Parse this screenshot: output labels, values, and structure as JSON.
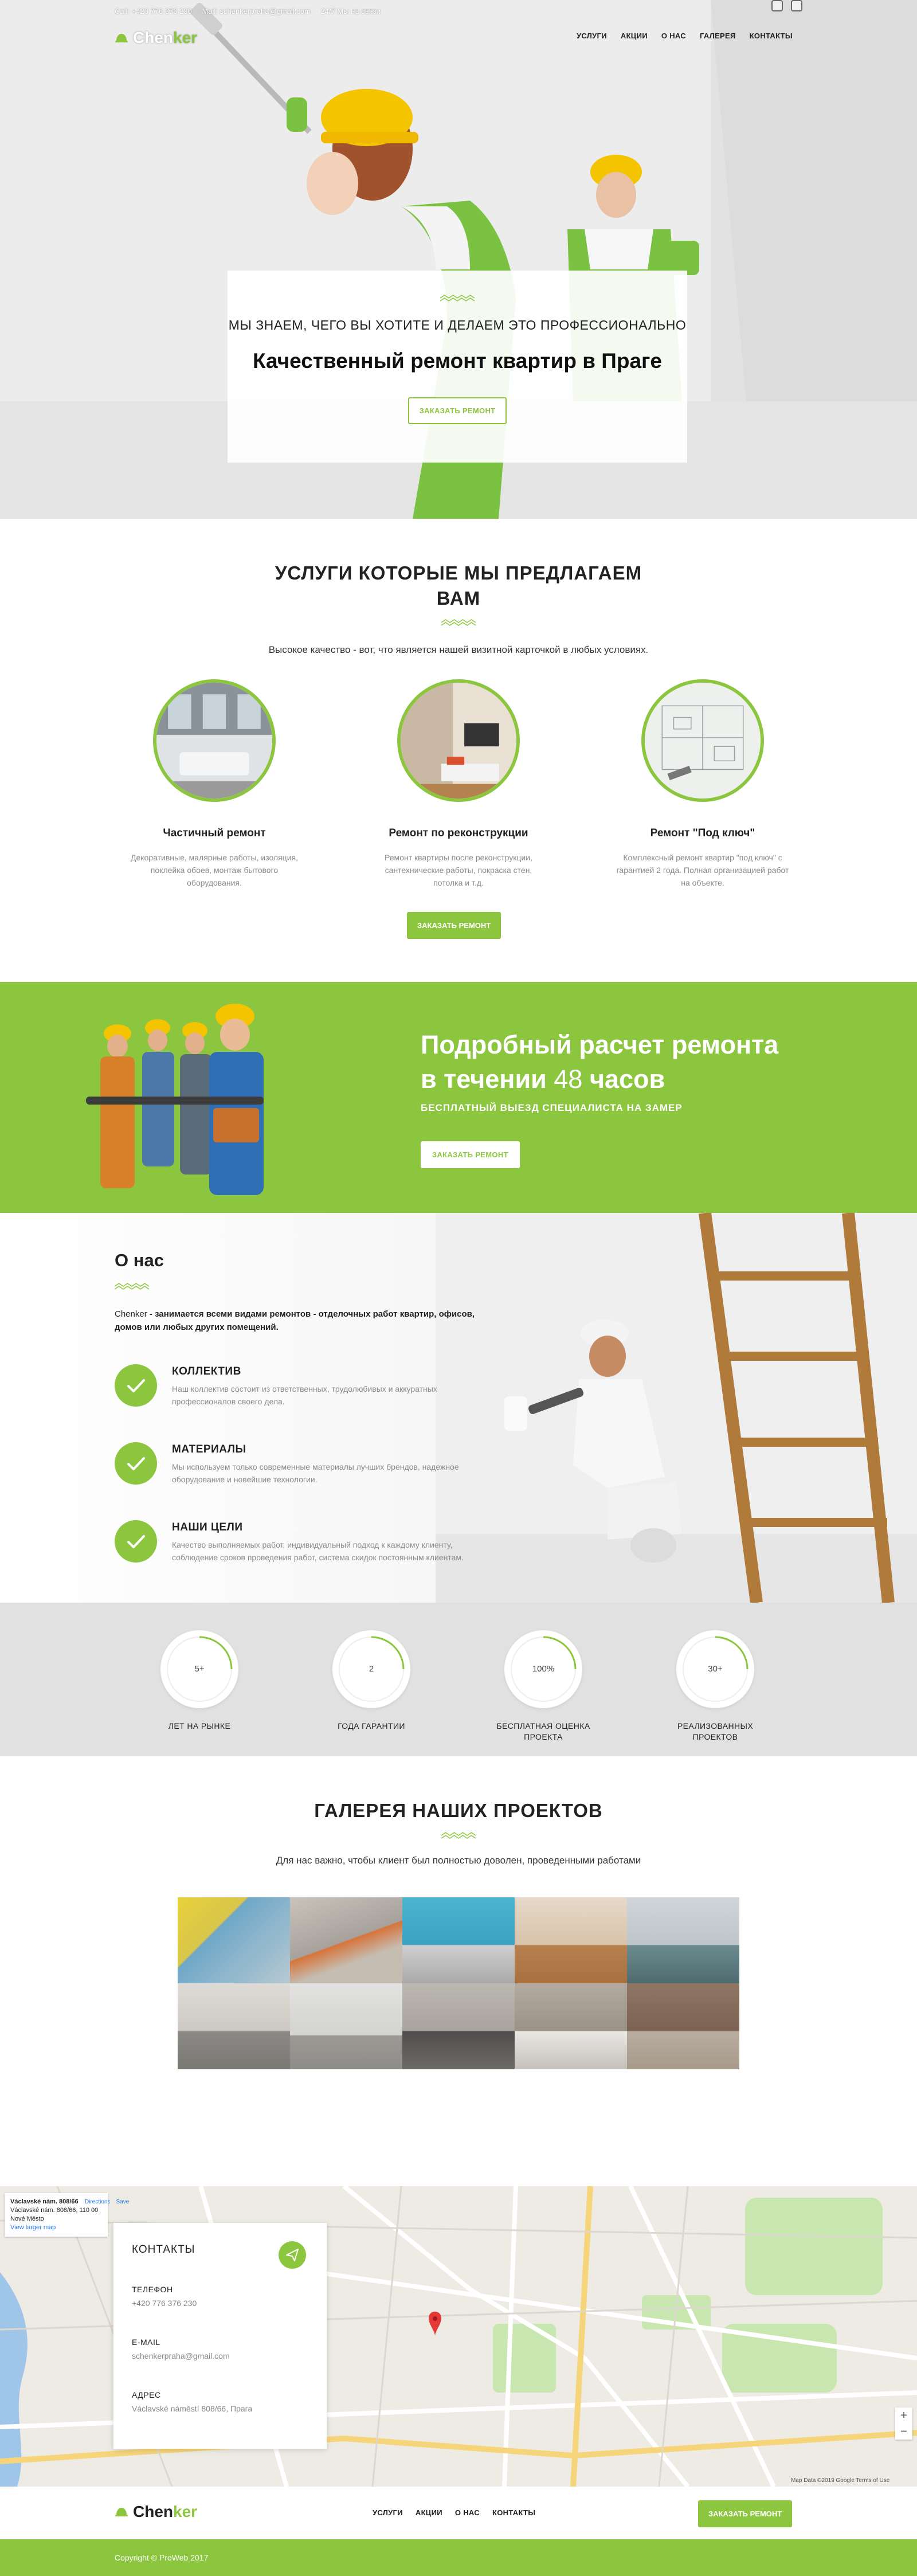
{
  "topbar": {
    "call": "Call: +420 776 376 230",
    "mail": "Mail: schenkerpraha@gmail.com",
    "hours": "24/7 Мы на связи"
  },
  "brand": {
    "part1": "Chen",
    "part2": "ker"
  },
  "nav": [
    "УСЛУГИ",
    "АКЦИИ",
    "О НАС",
    "ГАЛЕРЕЯ",
    "КОНТАКТЫ"
  ],
  "hero": {
    "subtitle": "МЫ ЗНАЕМ, ЧЕГО ВЫ ХОТИТЕ И ДЕЛАЕМ ЭТО ПРОФЕССИОНАЛЬНО",
    "title": "Качественный ремонт квартир в Праге",
    "button": "ЗАКАЗАТЬ РЕМОНТ"
  },
  "services": {
    "heading_line1": "УСЛУГИ КОТОРЫЕ МЫ ПРЕДЛАГАЕМ",
    "heading_line2": "ВАМ",
    "lead": "Высокое качество - вот, что является нашей визитной карточкой в любых условиях.",
    "items": [
      {
        "name": "Частичный ремонт",
        "desc": "Декоративные, малярные работы, изоляция, поклейка обоев, монтаж бытового оборудования."
      },
      {
        "name": "Ремонт по реконструкции",
        "desc": "Ремонт квартиры после реконструкции, сантехнические работы, покраска стен, потолка и т.д."
      },
      {
        "name": "Ремонт \"Под ключ\"",
        "desc": "Комплексный ремонт квартир \"под ключ\" с гарантией 2 года. Полная организацией работ на объекте."
      }
    ],
    "button": "ЗАКАЗАТЬ РЕМОНТ"
  },
  "calc": {
    "title_line1": "Подробный расчет ремонта",
    "title_pre": "в течении",
    "title_num": "48",
    "title_post": "часов",
    "subtitle": "БЕСПЛАТНЫЙ ВЫЕЗД СПЕЦИАЛИСТА НА ЗАМЕР",
    "button": "ЗАКАЗАТЬ РЕМОНТ"
  },
  "about": {
    "heading": "О нас",
    "intro_brand": "Chenker",
    "intro_rest": " - занимается всеми видами ремонтов - отделочных работ квартир, офисов, домов или любых других помещений.",
    "features": [
      {
        "title": "КОЛЛЕКТИВ",
        "desc": "Наш коллектив состоит из ответственных, трудолюбивых и аккуратных профессионалов своего дела."
      },
      {
        "title": "МАТЕРИАЛЫ",
        "desc": "Мы используем только современные материалы лучших брендов, надежное оборудование и новейшие технологии."
      },
      {
        "title": "НАШИ ЦЕЛИ",
        "desc": "Качество выполняемых работ, индивидуальный подход к каждому клиенту, соблюдение сроков проведения работ, система скидок постоянным клиентам."
      }
    ]
  },
  "stats": [
    {
      "value": "5+",
      "label": "ЛЕТ НА РЫНКЕ",
      "progress": 0.25
    },
    {
      "value": "2",
      "label": "ГОДА ГАРАНТИИ",
      "progress": 0.25
    },
    {
      "value": "100%",
      "label": "БЕСПЛАТНАЯ ОЦЕНКА ПРОЕКТА",
      "progress": 0.25
    },
    {
      "value": "30+",
      "label": "РЕАЛИЗОВАННЫХ ПРОЕКТОВ",
      "progress": 0.25
    }
  ],
  "gallery": {
    "heading": "ГАЛЕРЕЯ НАШИХ ПРОЕКТОВ",
    "lead": "Для нас важно, чтобы клиент был полностью доволен, проведенными работами"
  },
  "map": {
    "place": "Václavské nám. 808/66",
    "address_line1": "Václavské nám. 808/66, 110 00",
    "address_line2": "Nové Město",
    "larger_map": "View larger map",
    "directions": "Directions",
    "save": "Save",
    "attribution": "Map Data ©2019 Google   Terms of Use"
  },
  "contact": {
    "heading": "КОНТАКТЫ",
    "phone_label": "ТЕЛЕФОН",
    "phone": "+420 776 376 230",
    "email_label": "E-MAIL",
    "email": "schenkerpraha@gmail.com",
    "address_label": "АДРЕС",
    "address": "Václavské náměstí 808/66, Прага"
  },
  "footer": {
    "nav": [
      "УСЛУГИ",
      "АКЦИИ",
      "О НАС",
      "КОНТАКТЫ"
    ],
    "button": "ЗАКАЗАТЬ РЕМОНТ",
    "copyright": "Copyright © ProWeb 2017"
  },
  "colors": {
    "accent": "#8cc63f",
    "dark": "#222222",
    "muted": "#8a8a8a"
  }
}
